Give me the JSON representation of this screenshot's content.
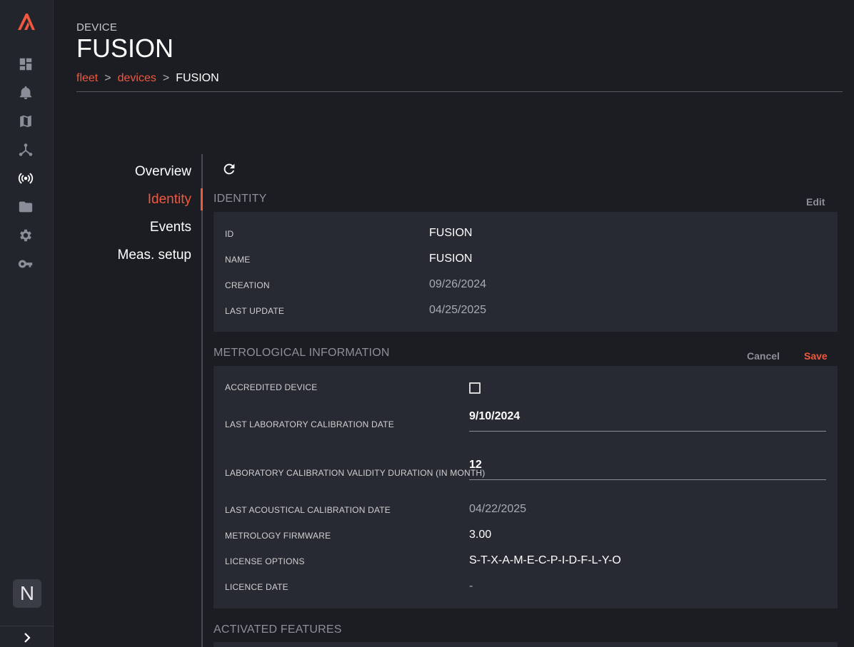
{
  "header": {
    "kicker": "DEVICE",
    "title": "FUSION",
    "breadcrumb": [
      {
        "label": "fleet"
      },
      {
        "label": "devices"
      },
      {
        "label": "FUSION"
      }
    ],
    "separator": ">"
  },
  "sidebar": {
    "icons": [
      "dashboard-icon",
      "bell-icon",
      "map-icon",
      "network-icon",
      "broadcast-icon",
      "folder-icon",
      "gear-icon",
      "key-icon"
    ],
    "active": "broadcast-icon",
    "avatar": "N",
    "accent": "#f0583f"
  },
  "tabs": [
    {
      "label": "Overview"
    },
    {
      "label": "Identity",
      "active": true
    },
    {
      "label": "Events"
    },
    {
      "label": "Meas. setup"
    }
  ],
  "identity": {
    "title": "IDENTITY",
    "edit_label": "Edit",
    "rows": [
      {
        "label": "ID",
        "value": "FUSION"
      },
      {
        "label": "NAME",
        "value": "FUSION"
      },
      {
        "label": "CREATION",
        "value": "09/26/2024"
      },
      {
        "label": "LAST UPDATE",
        "value": "04/25/2025"
      }
    ]
  },
  "metrological": {
    "title": "METROLOGICAL INFORMATION",
    "cancel_label": "Cancel",
    "save_label": "Save",
    "accredited_label": "ACCREDITED DEVICE",
    "accredited_checked": false,
    "lab_cal_date_label": "LAST LABORATORY CALIBRATION DATE",
    "lab_cal_date_value": "9/10/2024",
    "validity_label": "LABORATORY CALIBRATION VALIDITY DURATION (IN MONTH)",
    "validity_value": "12",
    "acoustic_label": "LAST ACOUSTICAL CALIBRATION DATE",
    "acoustic_value": "04/22/2025",
    "firmware_label": "METROLOGY FIRMWARE",
    "firmware_value": "3.00",
    "license_label": "LICENSE OPTIONS",
    "license_value": "S-T-X-A-M-E-C-P-I-D-F-L-Y-O",
    "licence_date_label": "LICENCE DATE",
    "licence_date_value": "-"
  },
  "activated": {
    "title": "ACTIVATED FEATURES"
  }
}
